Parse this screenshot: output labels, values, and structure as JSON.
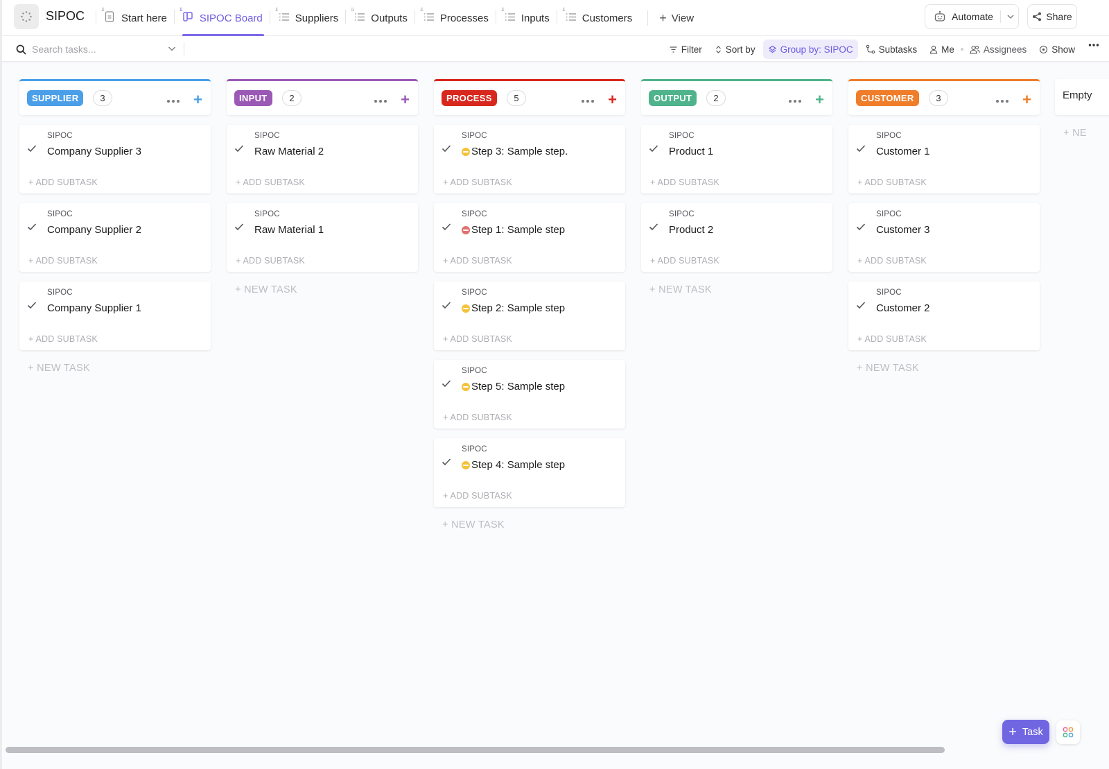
{
  "header": {
    "space_title": "SIPOC",
    "tabs": [
      {
        "label": "Start here",
        "icon": "doc-icon",
        "pinned": true,
        "active": false
      },
      {
        "label": "SIPOC Board",
        "icon": "board-icon",
        "pinned": true,
        "active": true
      },
      {
        "label": "Suppliers",
        "icon": "list-icon",
        "pinned": true,
        "active": false
      },
      {
        "label": "Outputs",
        "icon": "list-icon",
        "pinned": true,
        "active": false
      },
      {
        "label": "Processes",
        "icon": "list-icon",
        "pinned": true,
        "active": false
      },
      {
        "label": "Inputs",
        "icon": "list-icon",
        "pinned": true,
        "active": false
      },
      {
        "label": "Customers",
        "icon": "list-icon",
        "pinned": true,
        "active": false
      }
    ],
    "add_view_label": "View",
    "automate_label": "Automate",
    "share_label": "Share"
  },
  "toolbar": {
    "search_placeholder": "Search tasks...",
    "filter_label": "Filter",
    "sort_label": "Sort by",
    "group_label": "Group by: SIPOC",
    "subtasks_label": "Subtasks",
    "me_label": "Me",
    "assignees_label": "Assignees",
    "show_label": "Show"
  },
  "board": {
    "columns": [
      {
        "name": "SUPPLIER",
        "count": "3",
        "color": "#4a9fe8",
        "cards": [
          {
            "list": "SIPOC",
            "title": "Company Supplier 3",
            "priority": null
          },
          {
            "list": "SIPOC",
            "title": "Company Supplier 2",
            "priority": null
          },
          {
            "list": "SIPOC",
            "title": "Company Supplier 1",
            "priority": null
          }
        ]
      },
      {
        "name": "INPUT",
        "count": "2",
        "color": "#9b59b6",
        "cards": [
          {
            "list": "SIPOC",
            "title": "Raw Material 2",
            "priority": null
          },
          {
            "list": "SIPOC",
            "title": "Raw Material 1",
            "priority": null
          }
        ]
      },
      {
        "name": "PROCESS",
        "count": "5",
        "color": "#d8271d",
        "cards": [
          {
            "list": "SIPOC",
            "title": "Step 3: Sample step.",
            "priority": "#f5c23c"
          },
          {
            "list": "SIPOC",
            "title": "Step 1: Sample step",
            "priority": "#e0706d"
          },
          {
            "list": "SIPOC",
            "title": "Step 2: Sample step",
            "priority": "#f5c23c"
          },
          {
            "list": "SIPOC",
            "title": "Step 5: Sample step",
            "priority": "#f5c23c"
          },
          {
            "list": "SIPOC",
            "title": "Step 4: Sample step",
            "priority": "#f5c23c"
          }
        ]
      },
      {
        "name": "OUTPUT",
        "count": "2",
        "color": "#4fb38c",
        "cards": [
          {
            "list": "SIPOC",
            "title": "Product 1",
            "priority": null
          },
          {
            "list": "SIPOC",
            "title": "Product 2",
            "priority": null
          }
        ]
      },
      {
        "name": "CUSTOMER",
        "count": "3",
        "color": "#ef7d2a",
        "cards": [
          {
            "list": "SIPOC",
            "title": "Customer 1",
            "priority": null
          },
          {
            "list": "SIPOC",
            "title": "Customer 3",
            "priority": null
          },
          {
            "list": "SIPOC",
            "title": "Customer 2",
            "priority": null
          }
        ]
      }
    ],
    "add_subtask_label": "+ ADD SUBTASK",
    "new_task_label": "+ NEW TASK",
    "empty_column_name": "Empty",
    "empty_column_new": "+ NE"
  },
  "fab": {
    "task_label": "Task"
  }
}
